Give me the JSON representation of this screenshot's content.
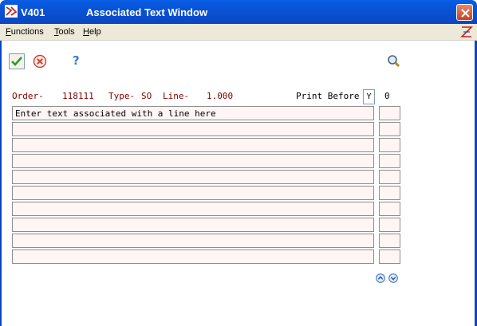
{
  "window": {
    "program_id": "V401",
    "title": "Associated Text Window"
  },
  "menu": [
    {
      "accel": "F",
      "rest": "unctions"
    },
    {
      "accel": "T",
      "rest": "ools"
    },
    {
      "accel": "H",
      "rest": "elp"
    }
  ],
  "toolbar": {
    "ok_icon": "check-icon",
    "cancel_icon": "cancel-x-icon",
    "help_icon": "question-mark-icon",
    "search_icon": "magnifier-icon"
  },
  "header": {
    "order_label": "Order-",
    "order_value": "118111",
    "type_label": "Type-",
    "type_value": "SO",
    "line_label": "Line-",
    "line_value": "1.000",
    "print_before_label": "Print Before",
    "print_before_value": "Y",
    "count_value": "0"
  },
  "lines": [
    {
      "text": "Enter text associated with a line here"
    },
    {
      "text": ""
    },
    {
      "text": ""
    },
    {
      "text": ""
    },
    {
      "text": ""
    },
    {
      "text": ""
    },
    {
      "text": ""
    },
    {
      "text": ""
    },
    {
      "text": ""
    },
    {
      "text": ""
    }
  ],
  "colors": {
    "titlebar": "#0a5fe6",
    "label_text": "#800000",
    "field_bg": "#fff5f5"
  }
}
